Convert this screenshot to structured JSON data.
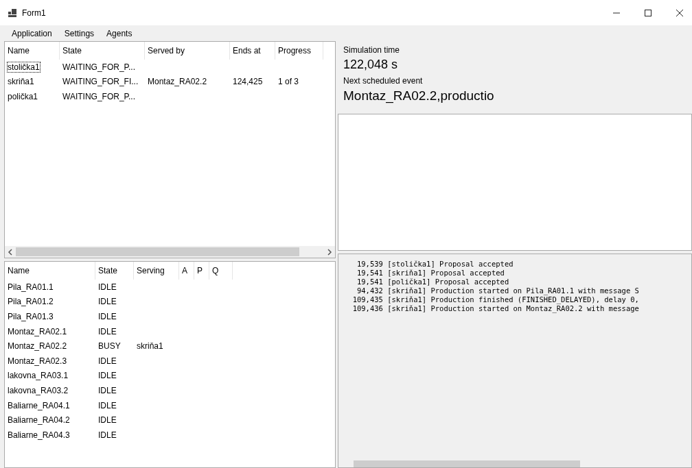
{
  "window": {
    "title": "Form1"
  },
  "menu": [
    "Application",
    "Settings",
    "Agents"
  ],
  "orders": {
    "columns": [
      "Name",
      "State",
      "Served by",
      "Ends at",
      "Progress"
    ],
    "rows": [
      {
        "cells": [
          "stolička1",
          "WAITING_FOR_P...",
          "",
          "",
          ""
        ],
        "selected": true
      },
      {
        "cells": [
          "skriňa1",
          "WAITING_FOR_FI...",
          "Montaz_RA02.2",
          "124,425",
          "1 of 3"
        ],
        "selected": false
      },
      {
        "cells": [
          "polička1",
          "WAITING_FOR_P...",
          "",
          "",
          ""
        ],
        "selected": false
      }
    ]
  },
  "simulation": {
    "time_label": "Simulation time",
    "time": "122,048 s",
    "event_label": "Next scheduled event",
    "event": "Montaz_RA02.2,productio"
  },
  "machines": {
    "columns": [
      "Name",
      "State",
      "Serving",
      "A",
      "P",
      "Q"
    ],
    "rows": [
      [
        "Pila_RA01.1",
        "IDLE",
        ""
      ],
      [
        "Pila_RA01.2",
        "IDLE",
        ""
      ],
      [
        "Pila_RA01.3",
        "IDLE",
        ""
      ],
      [
        "Montaz_RA02.1",
        "IDLE",
        ""
      ],
      [
        "Montaz_RA02.2",
        "BUSY",
        "skriňa1"
      ],
      [
        "Montaz_RA02.3",
        "IDLE",
        ""
      ],
      [
        "lakovna_RA03.1",
        "IDLE",
        ""
      ],
      [
        "lakovna_RA03.2",
        "IDLE",
        ""
      ],
      [
        "Baliarne_RA04.1",
        "IDLE",
        ""
      ],
      [
        "Baliarne_RA04.2",
        "IDLE",
        ""
      ],
      [
        "Baliarne_RA04.3",
        "IDLE",
        ""
      ]
    ]
  },
  "log": [
    "   19,539 [stolička1] Proposal accepted",
    "   19,541 [skriňa1] Proposal accepted",
    "   19,541 [polička1] Proposal accepted",
    "   94,432 [skriňa1] Production started on Pila_RA01.1 with message S",
    "  109,435 [skriňa1] Production finished (FINISHED_DELAYED), delay 0,",
    "  109,436 [skriňa1] Production started on Montaz_RA02.2 with message"
  ]
}
